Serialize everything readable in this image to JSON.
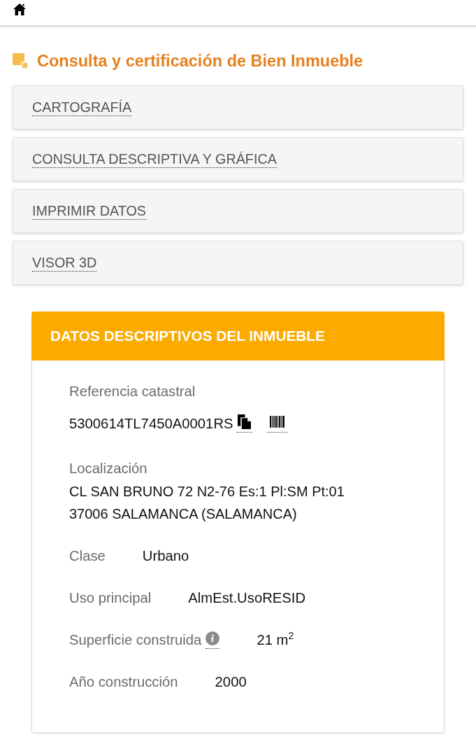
{
  "section": {
    "title": "Consulta y certificación de Bien Inmueble"
  },
  "menu": [
    {
      "label": "CARTOGRAFÍA"
    },
    {
      "label": "CONSULTA DESCRIPTIVA Y GRÁFICA"
    },
    {
      "label": "IMPRIMIR DATOS"
    },
    {
      "label": "VISOR 3D"
    }
  ],
  "panel": {
    "title": "DATOS DESCRIPTIVOS DEL INMUEBLE",
    "reference": {
      "label": "Referencia catastral",
      "value": "5300614TL7450A0001RS"
    },
    "location": {
      "label": "Localización",
      "lines": [
        "CL SAN BRUNO 72 N2-76 Es:1 Pl:SM Pt:01",
        "37006 SALAMANCA (SALAMANCA)"
      ]
    },
    "fields": [
      {
        "label": "Clase",
        "value": "Urbano",
        "info": false
      },
      {
        "label": "Uso principal",
        "value": "AlmEst.UsoRESID",
        "info": false
      },
      {
        "label": "Superficie construida",
        "value": "21 m$^{2}$",
        "info": true
      },
      {
        "label": "Año construcción",
        "value": "2000",
        "info": false
      }
    ]
  }
}
